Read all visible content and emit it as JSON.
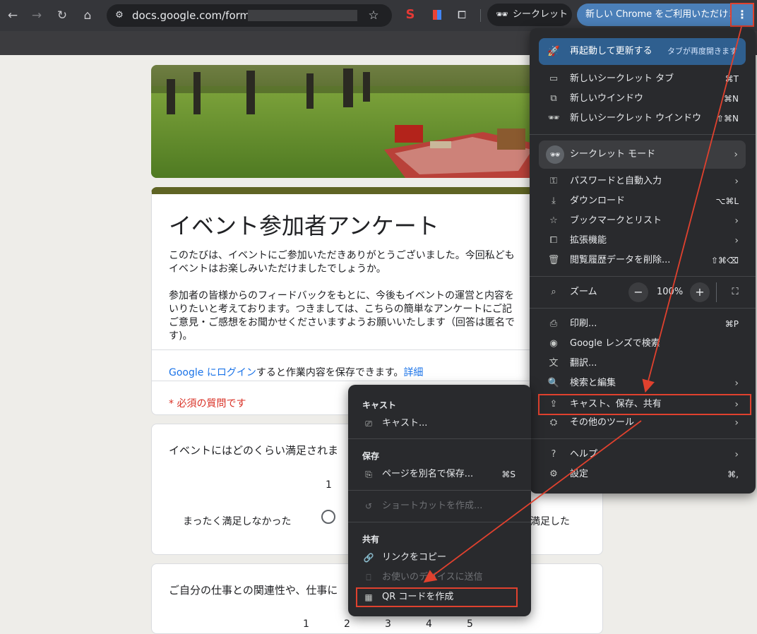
{
  "browser": {
    "url": "docs.google.com/forms/c",
    "incognito_chip": "シークレット",
    "update_chip": "新しい Chrome をご利用いただけます",
    "accent": "#4b7fb8"
  },
  "form": {
    "title": "イベント参加者アンケート",
    "description": "このたびは、イベントにご参加いただきありがとうございました。今回私ども\nイベントはお楽しみいただけましたでしょうか。\n\n参加者の皆様からのフィードバックをもとに、今後もイベントの運営と内容を\nいりたいと考えております。つきましては、こちらの簡単なアンケートにご記\nご意見・ご感想をお聞かせくださいますようお願いいたします（回答は匿名で\nす)。",
    "login_link": "Google にログイン",
    "login_text": "すると作業内容を保存できます。",
    "login_more": "詳細",
    "required_note": "* 必須の質問です",
    "q1": {
      "title": "イベントにはどのくらい満足されま",
      "scale_first": "1",
      "low_label": "まったく満足しなかった",
      "high_label": "満足した"
    },
    "q2": {
      "title": "ご自分の仕事との関連性や、仕事に",
      "scale": [
        "1",
        "2",
        "3",
        "4",
        "5"
      ]
    }
  },
  "menu": {
    "relaunch": {
      "label": "再起動して更新する",
      "sub": "タブが再度開きます"
    },
    "items_top": [
      {
        "icon": "new-incognito-tab-icon",
        "glyph": "▭",
        "label": "新しいシークレット タブ",
        "shortcut": "⌘T"
      },
      {
        "icon": "new-window-icon",
        "glyph": "⧉",
        "label": "新しいウインドウ",
        "shortcut": "⌘N"
      },
      {
        "icon": "incognito-window-icon",
        "glyph": "🕶",
        "label": "新しいシークレット ウインドウ",
        "shortcut": "⇧⌘N"
      }
    ],
    "incognito_mode": "シークレット モード",
    "items_mid": [
      {
        "icon": "key-icon",
        "glyph": "⚿",
        "label": "パスワードと自動入力",
        "shortcut": "",
        "sub": true
      },
      {
        "icon": "download-icon",
        "glyph": "⤓",
        "label": "ダウンロード",
        "shortcut": "⌥⌘L",
        "sub": false
      },
      {
        "icon": "star-icon",
        "glyph": "☆",
        "label": "ブックマークとリスト",
        "shortcut": "",
        "sub": true
      },
      {
        "icon": "extension-icon",
        "glyph": "⧠",
        "label": "拡張機能",
        "shortcut": "",
        "sub": true
      },
      {
        "icon": "trash-icon",
        "glyph": "🗑",
        "label": "閲覧履歴データを削除...",
        "shortcut": "⇧⌘⌫",
        "sub": false
      }
    ],
    "zoom": {
      "label": "ズーム",
      "value": "100%",
      "minus": "−",
      "plus": "+"
    },
    "items_bottom": [
      {
        "icon": "print-icon",
        "glyph": "⎙",
        "label": "印刷...",
        "shortcut": "⌘P",
        "sub": false
      },
      {
        "icon": "google-lens-icon",
        "glyph": "◉",
        "label": "Google レンズで検索",
        "shortcut": "",
        "sub": false
      },
      {
        "icon": "translate-icon",
        "glyph": "文",
        "label": "翻訳...",
        "shortcut": "",
        "sub": false
      },
      {
        "icon": "find-edit-icon",
        "glyph": "🔍",
        "label": "検索と編集",
        "shortcut": "",
        "sub": true
      },
      {
        "icon": "cast-save-share-icon",
        "glyph": "⇪",
        "label": "キャスト、保存、共有",
        "shortcut": "",
        "sub": true
      },
      {
        "icon": "more-tools-icon",
        "glyph": "⛭",
        "label": "その他のツール",
        "shortcut": "",
        "sub": true
      }
    ],
    "items_help": [
      {
        "icon": "help-icon",
        "glyph": "?",
        "label": "ヘルプ",
        "shortcut": "",
        "sub": true
      },
      {
        "icon": "settings-icon",
        "glyph": "⚙",
        "label": "設定",
        "shortcut": "⌘,",
        "sub": false
      }
    ]
  },
  "submenu": {
    "cast_head": "キャスト",
    "cast_item": "キャスト...",
    "save_head": "保存",
    "save_item": "ページを別名で保存...",
    "save_shortcut": "⌘S",
    "shortcut_item": "ショートカットを作成...",
    "share_head": "共有",
    "copy_link": "リンクをコピー",
    "send_devices": "お使いのデバイスに送信",
    "qr_code": "QR コードを作成"
  },
  "annotation_color": "#e0412e"
}
